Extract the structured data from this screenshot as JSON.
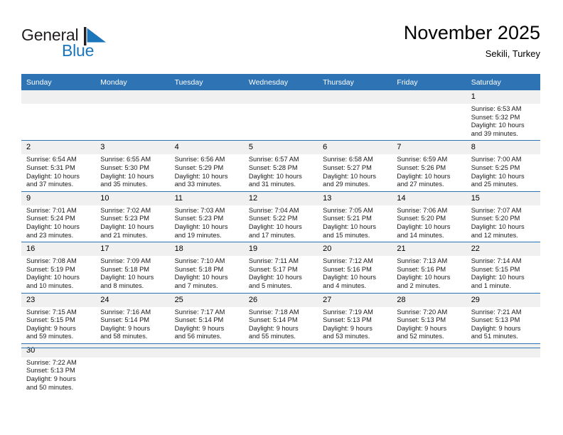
{
  "brand": {
    "name_part1": "General",
    "name_part2": "Blue",
    "flag_icon": "blue-triangle-flag-icon"
  },
  "header": {
    "title": "November 2025",
    "subtitle": "Sekili, Turkey"
  },
  "colors": {
    "header_blue": "#2e74b5",
    "brand_blue": "#1b75bb",
    "daynum_bg": "#f0f0f0",
    "text": "#000000"
  },
  "weekday_headers": [
    "Sunday",
    "Monday",
    "Tuesday",
    "Wednesday",
    "Thursday",
    "Friday",
    "Saturday"
  ],
  "weeks": [
    [
      {
        "day": "",
        "blank": true,
        "sunrise": "",
        "sunset": "",
        "daylight_line1": "",
        "daylight_line2": ""
      },
      {
        "day": "",
        "blank": true,
        "sunrise": "",
        "sunset": "",
        "daylight_line1": "",
        "daylight_line2": ""
      },
      {
        "day": "",
        "blank": true,
        "sunrise": "",
        "sunset": "",
        "daylight_line1": "",
        "daylight_line2": ""
      },
      {
        "day": "",
        "blank": true,
        "sunrise": "",
        "sunset": "",
        "daylight_line1": "",
        "daylight_line2": ""
      },
      {
        "day": "",
        "blank": true,
        "sunrise": "",
        "sunset": "",
        "daylight_line1": "",
        "daylight_line2": ""
      },
      {
        "day": "",
        "blank": true,
        "sunrise": "",
        "sunset": "",
        "daylight_line1": "",
        "daylight_line2": ""
      },
      {
        "day": "1",
        "blank": false,
        "sunrise": "Sunrise: 6:53 AM",
        "sunset": "Sunset: 5:32 PM",
        "daylight_line1": "Daylight: 10 hours",
        "daylight_line2": "and 39 minutes."
      }
    ],
    [
      {
        "day": "2",
        "blank": false,
        "sunrise": "Sunrise: 6:54 AM",
        "sunset": "Sunset: 5:31 PM",
        "daylight_line1": "Daylight: 10 hours",
        "daylight_line2": "and 37 minutes."
      },
      {
        "day": "3",
        "blank": false,
        "sunrise": "Sunrise: 6:55 AM",
        "sunset": "Sunset: 5:30 PM",
        "daylight_line1": "Daylight: 10 hours",
        "daylight_line2": "and 35 minutes."
      },
      {
        "day": "4",
        "blank": false,
        "sunrise": "Sunrise: 6:56 AM",
        "sunset": "Sunset: 5:29 PM",
        "daylight_line1": "Daylight: 10 hours",
        "daylight_line2": "and 33 minutes."
      },
      {
        "day": "5",
        "blank": false,
        "sunrise": "Sunrise: 6:57 AM",
        "sunset": "Sunset: 5:28 PM",
        "daylight_line1": "Daylight: 10 hours",
        "daylight_line2": "and 31 minutes."
      },
      {
        "day": "6",
        "blank": false,
        "sunrise": "Sunrise: 6:58 AM",
        "sunset": "Sunset: 5:27 PM",
        "daylight_line1": "Daylight: 10 hours",
        "daylight_line2": "and 29 minutes."
      },
      {
        "day": "7",
        "blank": false,
        "sunrise": "Sunrise: 6:59 AM",
        "sunset": "Sunset: 5:26 PM",
        "daylight_line1": "Daylight: 10 hours",
        "daylight_line2": "and 27 minutes."
      },
      {
        "day": "8",
        "blank": false,
        "sunrise": "Sunrise: 7:00 AM",
        "sunset": "Sunset: 5:25 PM",
        "daylight_line1": "Daylight: 10 hours",
        "daylight_line2": "and 25 minutes."
      }
    ],
    [
      {
        "day": "9",
        "blank": false,
        "sunrise": "Sunrise: 7:01 AM",
        "sunset": "Sunset: 5:24 PM",
        "daylight_line1": "Daylight: 10 hours",
        "daylight_line2": "and 23 minutes."
      },
      {
        "day": "10",
        "blank": false,
        "sunrise": "Sunrise: 7:02 AM",
        "sunset": "Sunset: 5:23 PM",
        "daylight_line1": "Daylight: 10 hours",
        "daylight_line2": "and 21 minutes."
      },
      {
        "day": "11",
        "blank": false,
        "sunrise": "Sunrise: 7:03 AM",
        "sunset": "Sunset: 5:23 PM",
        "daylight_line1": "Daylight: 10 hours",
        "daylight_line2": "and 19 minutes."
      },
      {
        "day": "12",
        "blank": false,
        "sunrise": "Sunrise: 7:04 AM",
        "sunset": "Sunset: 5:22 PM",
        "daylight_line1": "Daylight: 10 hours",
        "daylight_line2": "and 17 minutes."
      },
      {
        "day": "13",
        "blank": false,
        "sunrise": "Sunrise: 7:05 AM",
        "sunset": "Sunset: 5:21 PM",
        "daylight_line1": "Daylight: 10 hours",
        "daylight_line2": "and 15 minutes."
      },
      {
        "day": "14",
        "blank": false,
        "sunrise": "Sunrise: 7:06 AM",
        "sunset": "Sunset: 5:20 PM",
        "daylight_line1": "Daylight: 10 hours",
        "daylight_line2": "and 14 minutes."
      },
      {
        "day": "15",
        "blank": false,
        "sunrise": "Sunrise: 7:07 AM",
        "sunset": "Sunset: 5:20 PM",
        "daylight_line1": "Daylight: 10 hours",
        "daylight_line2": "and 12 minutes."
      }
    ],
    [
      {
        "day": "16",
        "blank": false,
        "sunrise": "Sunrise: 7:08 AM",
        "sunset": "Sunset: 5:19 PM",
        "daylight_line1": "Daylight: 10 hours",
        "daylight_line2": "and 10 minutes."
      },
      {
        "day": "17",
        "blank": false,
        "sunrise": "Sunrise: 7:09 AM",
        "sunset": "Sunset: 5:18 PM",
        "daylight_line1": "Daylight: 10 hours",
        "daylight_line2": "and 8 minutes."
      },
      {
        "day": "18",
        "blank": false,
        "sunrise": "Sunrise: 7:10 AM",
        "sunset": "Sunset: 5:18 PM",
        "daylight_line1": "Daylight: 10 hours",
        "daylight_line2": "and 7 minutes."
      },
      {
        "day": "19",
        "blank": false,
        "sunrise": "Sunrise: 7:11 AM",
        "sunset": "Sunset: 5:17 PM",
        "daylight_line1": "Daylight: 10 hours",
        "daylight_line2": "and 5 minutes."
      },
      {
        "day": "20",
        "blank": false,
        "sunrise": "Sunrise: 7:12 AM",
        "sunset": "Sunset: 5:16 PM",
        "daylight_line1": "Daylight: 10 hours",
        "daylight_line2": "and 4 minutes."
      },
      {
        "day": "21",
        "blank": false,
        "sunrise": "Sunrise: 7:13 AM",
        "sunset": "Sunset: 5:16 PM",
        "daylight_line1": "Daylight: 10 hours",
        "daylight_line2": "and 2 minutes."
      },
      {
        "day": "22",
        "blank": false,
        "sunrise": "Sunrise: 7:14 AM",
        "sunset": "Sunset: 5:15 PM",
        "daylight_line1": "Daylight: 10 hours",
        "daylight_line2": "and 1 minute."
      }
    ],
    [
      {
        "day": "23",
        "blank": false,
        "sunrise": "Sunrise: 7:15 AM",
        "sunset": "Sunset: 5:15 PM",
        "daylight_line1": "Daylight: 9 hours",
        "daylight_line2": "and 59 minutes."
      },
      {
        "day": "24",
        "blank": false,
        "sunrise": "Sunrise: 7:16 AM",
        "sunset": "Sunset: 5:14 PM",
        "daylight_line1": "Daylight: 9 hours",
        "daylight_line2": "and 58 minutes."
      },
      {
        "day": "25",
        "blank": false,
        "sunrise": "Sunrise: 7:17 AM",
        "sunset": "Sunset: 5:14 PM",
        "daylight_line1": "Daylight: 9 hours",
        "daylight_line2": "and 56 minutes."
      },
      {
        "day": "26",
        "blank": false,
        "sunrise": "Sunrise: 7:18 AM",
        "sunset": "Sunset: 5:14 PM",
        "daylight_line1": "Daylight: 9 hours",
        "daylight_line2": "and 55 minutes."
      },
      {
        "day": "27",
        "blank": false,
        "sunrise": "Sunrise: 7:19 AM",
        "sunset": "Sunset: 5:13 PM",
        "daylight_line1": "Daylight: 9 hours",
        "daylight_line2": "and 53 minutes."
      },
      {
        "day": "28",
        "blank": false,
        "sunrise": "Sunrise: 7:20 AM",
        "sunset": "Sunset: 5:13 PM",
        "daylight_line1": "Daylight: 9 hours",
        "daylight_line2": "and 52 minutes."
      },
      {
        "day": "29",
        "blank": false,
        "sunrise": "Sunrise: 7:21 AM",
        "sunset": "Sunset: 5:13 PM",
        "daylight_line1": "Daylight: 9 hours",
        "daylight_line2": "and 51 minutes."
      }
    ],
    [
      {
        "day": "30",
        "blank": false,
        "sunrise": "Sunrise: 7:22 AM",
        "sunset": "Sunset: 5:13 PM",
        "daylight_line1": "Daylight: 9 hours",
        "daylight_line2": "and 50 minutes."
      },
      {
        "day": "",
        "blank": true,
        "sunrise": "",
        "sunset": "",
        "daylight_line1": "",
        "daylight_line2": ""
      },
      {
        "day": "",
        "blank": true,
        "sunrise": "",
        "sunset": "",
        "daylight_line1": "",
        "daylight_line2": ""
      },
      {
        "day": "",
        "blank": true,
        "sunrise": "",
        "sunset": "",
        "daylight_line1": "",
        "daylight_line2": ""
      },
      {
        "day": "",
        "blank": true,
        "sunrise": "",
        "sunset": "",
        "daylight_line1": "",
        "daylight_line2": ""
      },
      {
        "day": "",
        "blank": true,
        "sunrise": "",
        "sunset": "",
        "daylight_line1": "",
        "daylight_line2": ""
      },
      {
        "day": "",
        "blank": true,
        "sunrise": "",
        "sunset": "",
        "daylight_line1": "",
        "daylight_line2": ""
      }
    ]
  ]
}
